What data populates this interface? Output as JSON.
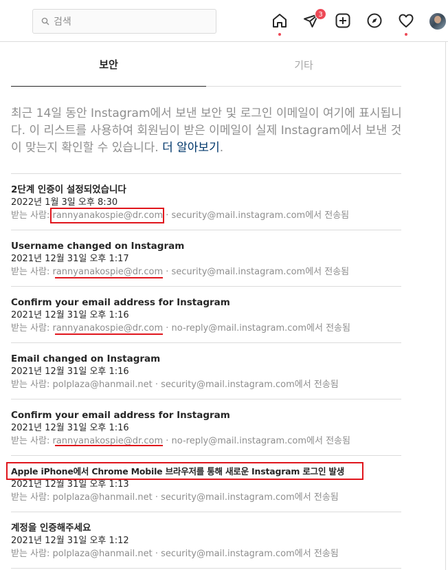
{
  "search": {
    "placeholder": "검색"
  },
  "nav": {
    "icons": [
      "home-icon",
      "direct-icon",
      "new-post-icon",
      "explore-icon",
      "activity-icon"
    ],
    "direct_badge": "3"
  },
  "tabs": [
    {
      "label": "보안"
    },
    {
      "label": "기타"
    }
  ],
  "description": {
    "text": "최근 14일 동안 Instagram에서 보낸 보안 및 로그인 이메일이 여기에 표시됩니다. 이 리스트를 사용하여 회원님이 받은 이메일이 실제 Instagram에서 보낸 것이 맞는지 확인할 수 있습니다. ",
    "link": "더 알아보기",
    "end": "."
  },
  "emails": [
    {
      "title": "2단계 인증이 설정되었습니다",
      "date": "2022년 1월 3일 오후 8:30",
      "prefix": "받는 사람: ",
      "to": "rannyanakospie@dr.com",
      "suffix": " · security@mail.instagram.com에서 전송됨"
    },
    {
      "title": "Username changed on Instagram",
      "date": "2021년 12월 31일 오후 1:17",
      "prefix": "받는 사람: ",
      "to": "rannyanakospie@dr.com",
      "suffix": " · security@mail.instagram.com에서 전송됨"
    },
    {
      "title": "Confirm your email address for Instagram",
      "date": "2021년 12월 31일 오후 1:16",
      "prefix": "받는 사람: ",
      "to": "rannyanakospie@dr.com",
      "suffix": " · no-reply@mail.instagram.com에서 전송됨"
    },
    {
      "title": "Email changed on Instagram",
      "date": "2021년 12월 31일 오후 1:16",
      "prefix": "받는 사람: ",
      "to": "polplaza@hanmail.net",
      "suffix": " · security@mail.instagram.com에서 전송됨"
    },
    {
      "title": "Confirm your email address for Instagram",
      "date": "2021년 12월 31일 오후 1:16",
      "prefix": "받는 사람: ",
      "to": "rannyanakospie@dr.com",
      "suffix": " · no-reply@mail.instagram.com에서 전송됨"
    },
    {
      "title": "Apple iPhone에서 Chrome Mobile 브라우저를 통해 새로운 Instagram 로그인 발생",
      "date": "2021년 12월 31일 오후 1:13",
      "prefix": "받는 사람: ",
      "to": "polplaza@hanmail.net",
      "suffix": " · security@mail.instagram.com에서 전송됨"
    },
    {
      "title": "계정을 인증해주세요",
      "date": "2021년 12월 31일 오후 1:12",
      "prefix": "받는 사람: ",
      "to": "polplaza@hanmail.net",
      "suffix": " · security@mail.instagram.com에서 전송됨"
    }
  ],
  "colors": {
    "annotation_red": "#e0151c",
    "link": "#00376b",
    "badge": "#ed4956"
  }
}
